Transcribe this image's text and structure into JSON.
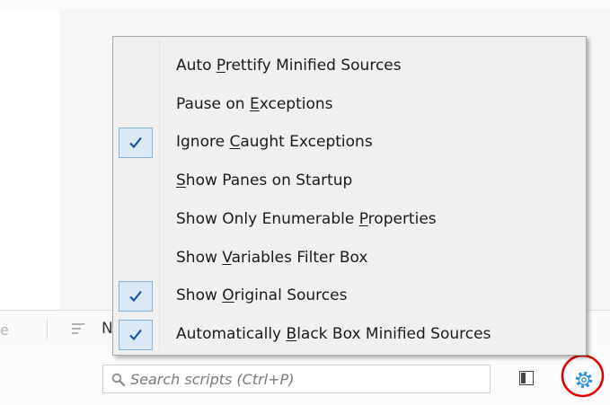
{
  "menu": {
    "items": [
      {
        "label": "Auto Prettify Minified Sources",
        "accel": "P",
        "checked": false
      },
      {
        "label": "Pause on Exceptions",
        "accel": "E",
        "checked": false
      },
      {
        "label": "Ignore Caught Exceptions",
        "accel": "C",
        "checked": true
      },
      {
        "label": "Show Panes on Startup",
        "accel": "S",
        "checked": false
      },
      {
        "label": "Show Only Enumerable Properties",
        "accel": "P",
        "checked": false
      },
      {
        "label": "Show Variables Filter Box",
        "accel": "V",
        "checked": false
      },
      {
        "label": "Show Original Sources",
        "accel": "O",
        "checked": true
      },
      {
        "label": "Automatically Black Box Minified Sources",
        "accel": "B",
        "checked": true
      }
    ]
  },
  "tabs": {
    "previous_label_partial": "e",
    "current_label_partial": "N"
  },
  "toolbar": {
    "search_placeholder": "Search scripts (Ctrl+P)"
  },
  "icons": {
    "search": "magnifier-icon",
    "sidebar_toggle": "toggle-pane-icon",
    "settings": "gear-icon",
    "tab": "lines-icon",
    "check": "checkmark-icon"
  },
  "colors": {
    "check_bg": "#dbe9f6",
    "check_border": "#84b2d6",
    "check_mark": "#1a4fa8",
    "settings_icon": "#2a8fe0",
    "highlight_ring": "#e00000"
  }
}
